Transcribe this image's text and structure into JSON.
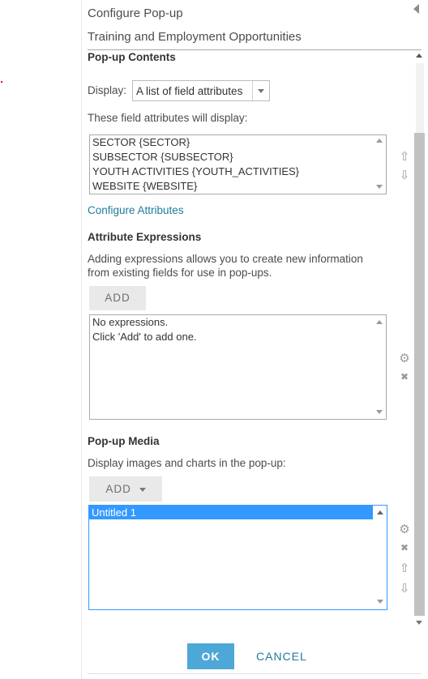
{
  "header": {
    "title": "Configure Pop-up",
    "layer_name": "Training and Employment Opportunities"
  },
  "contents": {
    "heading": "Pop-up Contents",
    "display_label": "Display:",
    "display_value": "A list of field attributes",
    "fields_label": "These field attributes will display:",
    "fields": [
      "SECTOR {SECTOR}",
      "SUBSECTOR {SUBSECTOR}",
      "YOUTH ACTIVITIES {YOUTH_ACTIVITIES}",
      "WEBSITE {WEBSITE}"
    ],
    "configure_link": "Configure Attributes"
  },
  "expressions": {
    "heading": "Attribute Expressions",
    "description_line1": "Adding expressions allows you to create new information",
    "description_line2": "from existing fields for use in pop-ups.",
    "add_label": "ADD",
    "empty_line1": "No expressions.",
    "empty_line2": "Click 'Add' to add one."
  },
  "media": {
    "heading": "Pop-up Media",
    "description": "Display images and charts in the pop-up:",
    "add_label": "ADD",
    "items": [
      "Untitled 1"
    ]
  },
  "footer": {
    "ok_label": "OK",
    "cancel_label": "CANCEL"
  },
  "icons": {
    "move_up": "⇧",
    "move_down": "⇩",
    "settings": "⚙",
    "delete": "✖"
  },
  "colors": {
    "accent": "#4da8d8",
    "link": "#1f7a9c",
    "selection": "#3399ff"
  }
}
